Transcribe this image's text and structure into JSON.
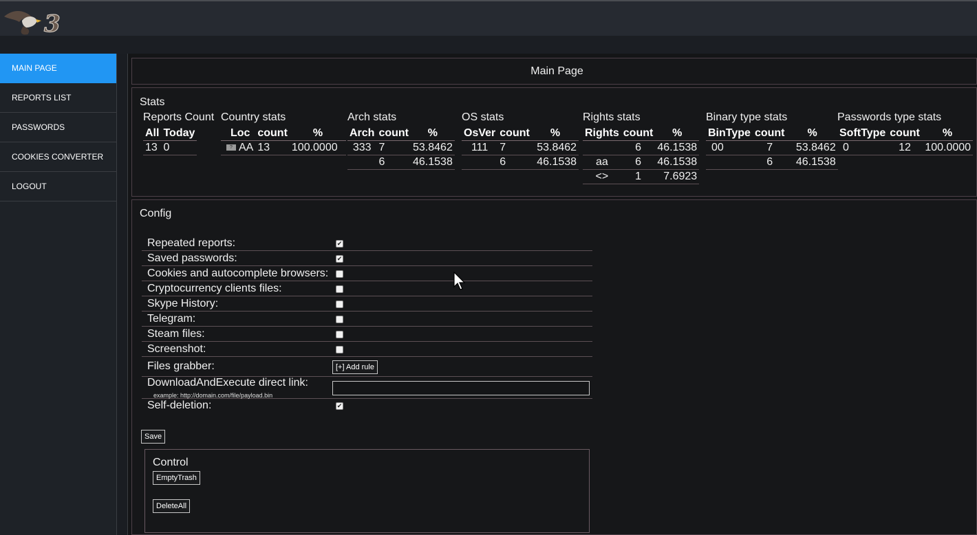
{
  "nav": {
    "items": [
      {
        "label": "MAIN PAGE",
        "active": true
      },
      {
        "label": "REPORTS LIST"
      },
      {
        "label": "PASSWORDS"
      },
      {
        "label": "COOKIES CONVERTER"
      },
      {
        "label": "LOGOUT"
      }
    ]
  },
  "page": {
    "title": "Main Page"
  },
  "stats": {
    "label": "Stats",
    "reports": {
      "title": "Reports Count",
      "headers": [
        "All",
        "Today"
      ],
      "rows": [
        [
          "13",
          "0"
        ]
      ]
    },
    "country": {
      "title": "Country stats",
      "headers": [
        "Loc",
        "count",
        "%"
      ],
      "flag_text": "?",
      "rows": [
        [
          "AA",
          "13",
          "100.0000"
        ]
      ]
    },
    "arch": {
      "title": "Arch stats",
      "headers": [
        "Arch",
        "count",
        "%"
      ],
      "rows": [
        [
          "333",
          "7",
          "53.8462"
        ],
        [
          "",
          "6",
          "46.1538"
        ]
      ]
    },
    "os": {
      "title": "OS stats",
      "headers": [
        "OsVer",
        "count",
        "%"
      ],
      "rows": [
        [
          "111",
          "7",
          "53.8462"
        ],
        [
          "",
          "6",
          "46.1538"
        ]
      ]
    },
    "rights": {
      "title": "Rights stats",
      "headers": [
        "Rights",
        "count",
        "%"
      ],
      "rows": [
        [
          "",
          "6",
          "46.1538"
        ],
        [
          "aa",
          "6",
          "46.1538"
        ],
        [
          "<>",
          "1",
          "7.6923"
        ]
      ]
    },
    "binary": {
      "title": "Binary type stats",
      "headers": [
        "BinType",
        "count",
        "%"
      ],
      "rows": [
        [
          "00",
          "7",
          "53.8462"
        ],
        [
          "",
          "6",
          "46.1538"
        ]
      ]
    },
    "passwords": {
      "title": "Passwords type stats",
      "headers": [
        "SoftType",
        "count",
        "%"
      ],
      "rows": [
        [
          "0",
          "12",
          "100.0000"
        ]
      ]
    }
  },
  "config": {
    "label": "Config",
    "options": [
      {
        "label": "Repeated reports:",
        "checked": true
      },
      {
        "label": "Saved passwords:",
        "checked": true
      },
      {
        "label": "Cookies and autocomplete browsers:",
        "checked": false
      },
      {
        "label": "Cryptocurrency clients files:",
        "checked": false
      },
      {
        "label": "Skype History:",
        "checked": false
      },
      {
        "label": "Telegram:",
        "checked": false
      },
      {
        "label": "Steam files:",
        "checked": false
      },
      {
        "label": "Screenshot:",
        "checked": false
      }
    ],
    "files_grabber": {
      "label": "Files grabber:",
      "button": "[+] Add rule"
    },
    "download_execute": {
      "label": "DownloadAndExecute direct link:",
      "example": "example: http://domain.com/file/payload.bin",
      "value": ""
    },
    "self_deletion": {
      "label": "Self-deletion:",
      "checked": true
    },
    "save_label": "Save"
  },
  "control": {
    "label": "Control",
    "empty_trash": "EmptyTrash",
    "delete_all": "DeleteAll"
  },
  "colors": {
    "accent": "#2196f3",
    "background": "#141517",
    "sidebar": "#1e2227"
  }
}
